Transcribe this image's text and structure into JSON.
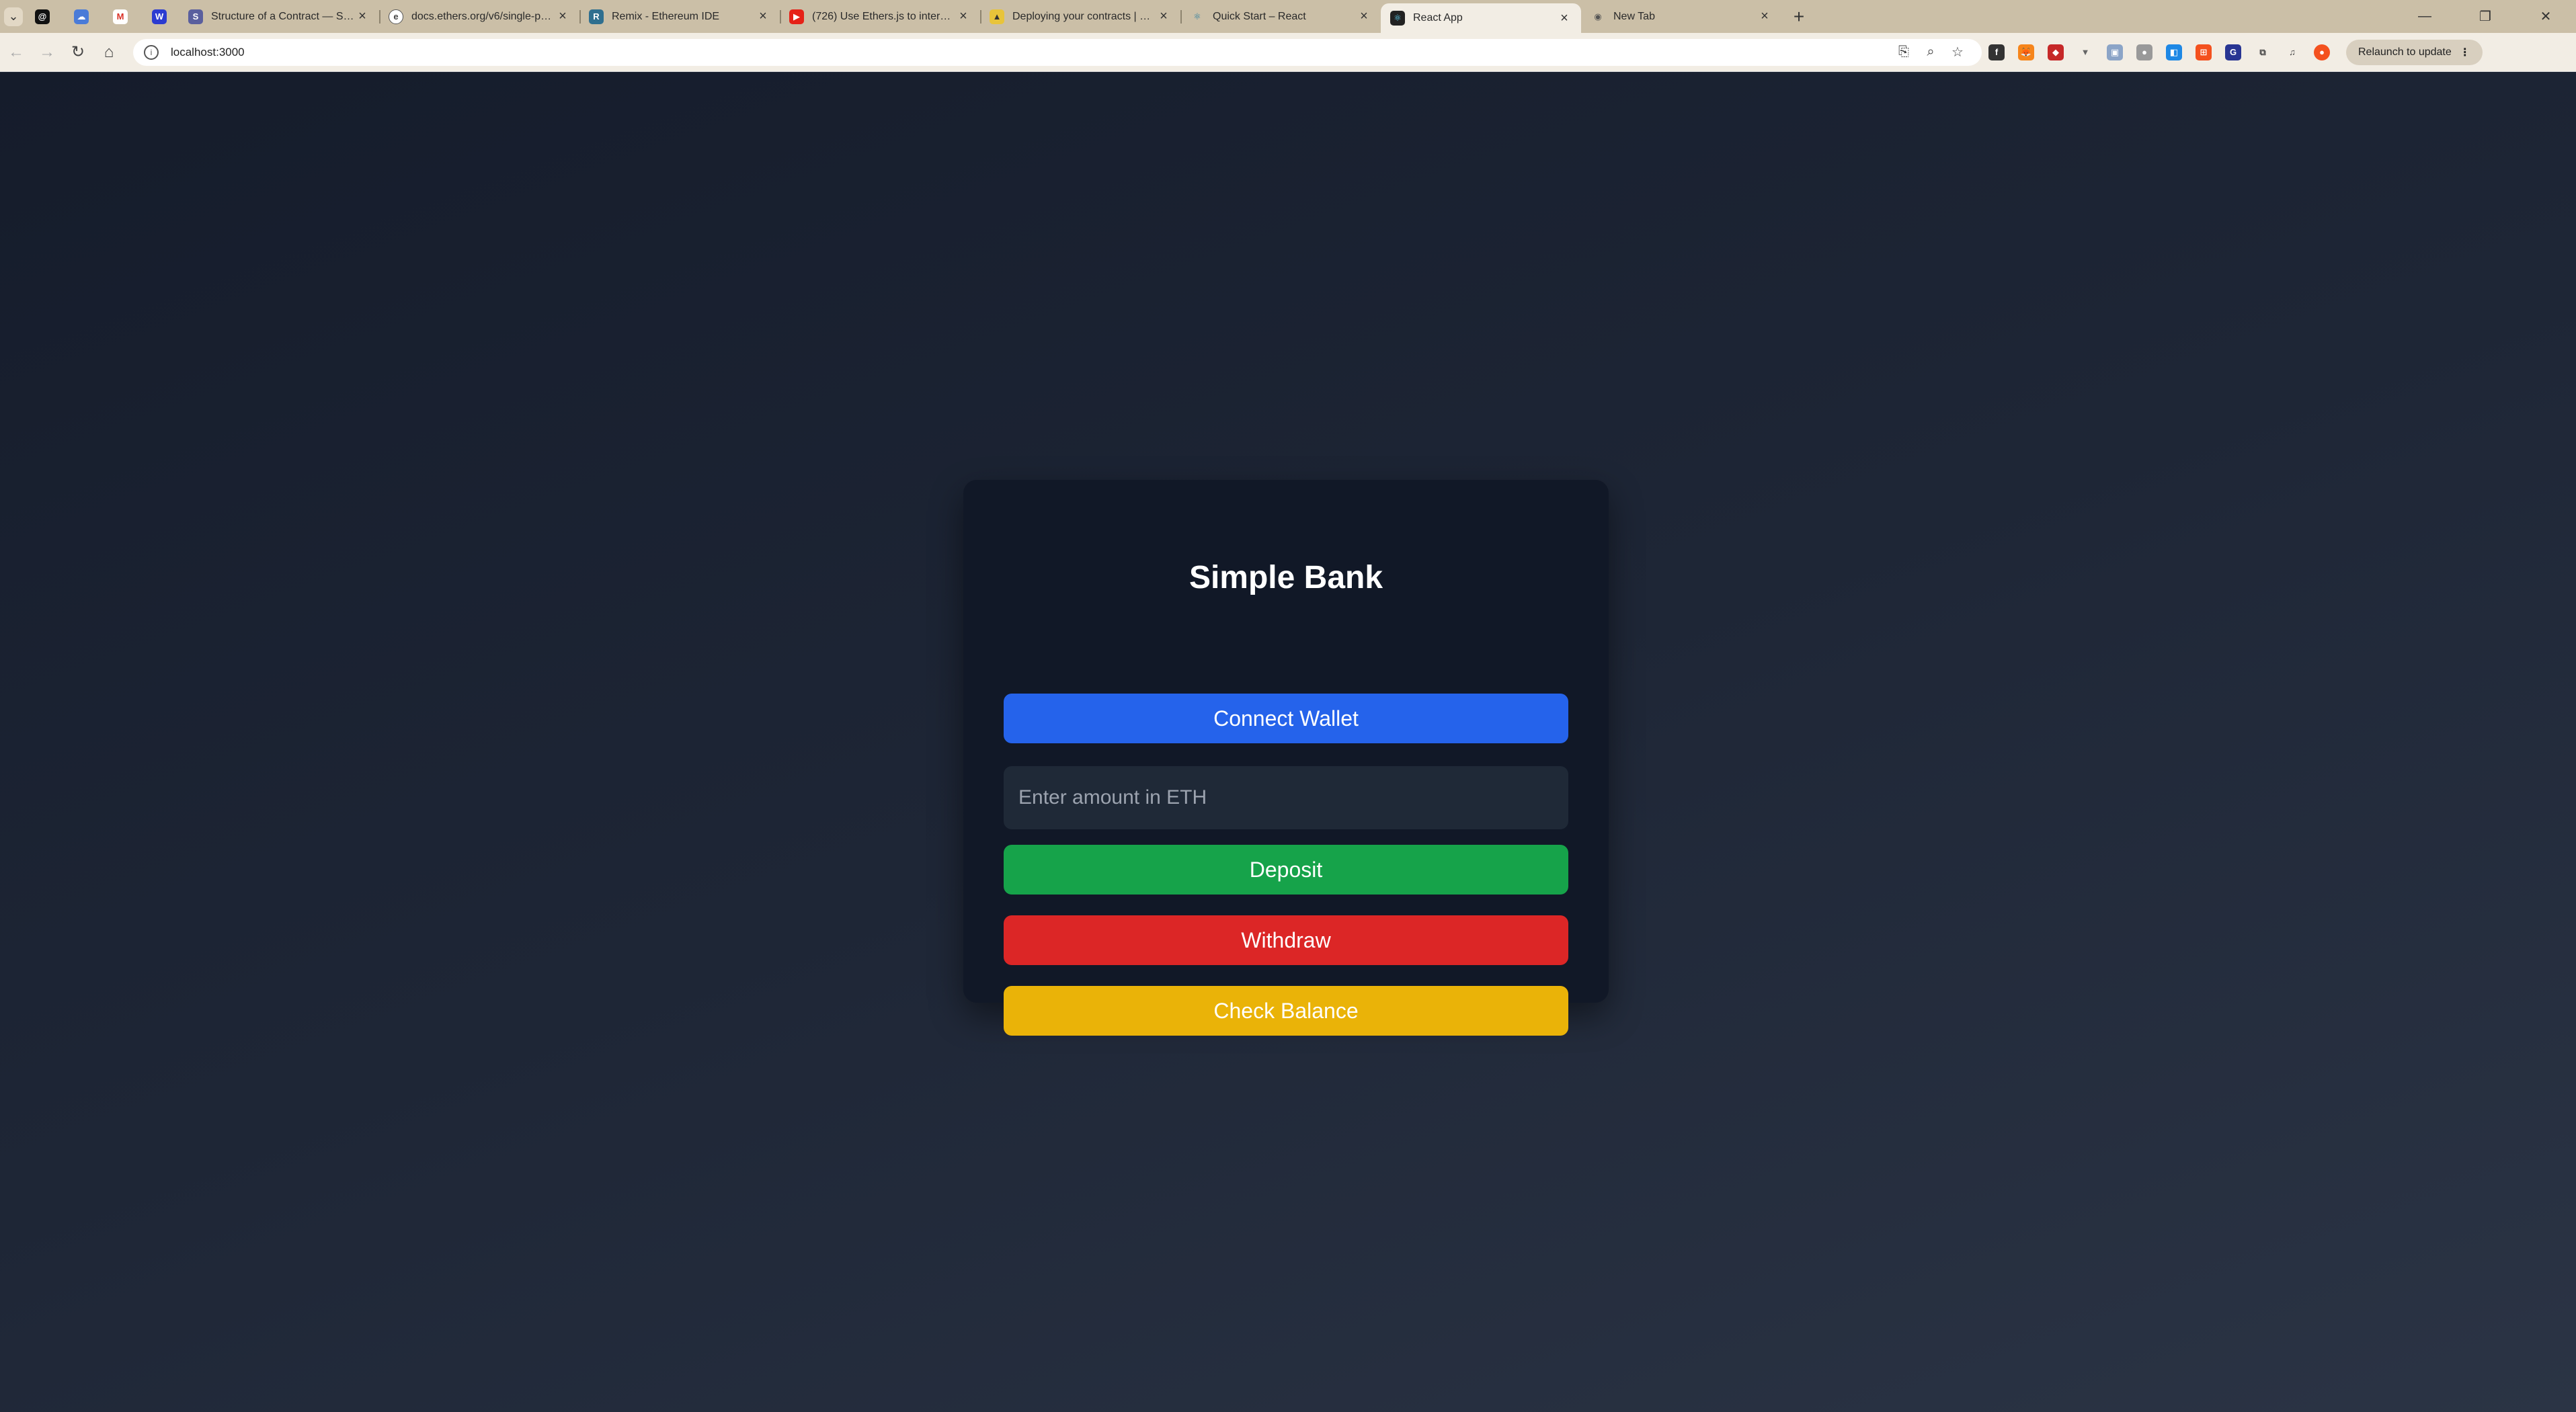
{
  "browser": {
    "tabs": [
      {
        "title": "Structure of a Contract — Solidity",
        "icon": "solidity-icon",
        "color": "#5a5f9e"
      },
      {
        "title": "docs.ethers.org/v6/single-page",
        "icon": "ethers-icon",
        "color": "#444444"
      },
      {
        "title": "Remix - Ethereum IDE",
        "icon": "remix-icon",
        "color": "#2f6f8f"
      },
      {
        "title": "(726) Use Ethers.js to interact with",
        "icon": "youtube-icon",
        "color": "#e62117"
      },
      {
        "title": "Deploying your contracts | Ethers",
        "icon": "hardhat-icon",
        "color": "#e8c43a"
      },
      {
        "title": "Quick Start – React",
        "icon": "react-icon",
        "color": "#58c4dc"
      },
      {
        "title": "React App",
        "icon": "react-icon",
        "color": "#222222",
        "active": true
      },
      {
        "title": "New Tab",
        "icon": "chrome-icon",
        "color": "#666666"
      }
    ],
    "url": "localhost:3000",
    "relaunch_label": "Relaunch to update"
  },
  "app": {
    "title": "Simple Bank",
    "connect_label": "Connect Wallet",
    "amount_placeholder": "Enter amount in ETH",
    "deposit_label": "Deposit",
    "withdraw_label": "Withdraw",
    "balance_label": "Check Balance"
  }
}
